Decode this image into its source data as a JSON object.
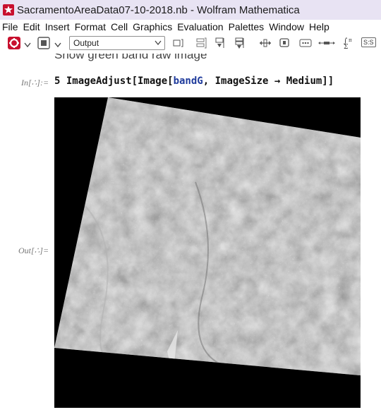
{
  "window": {
    "title": "SacramentoAreaData07-10-2018.nb - Wolfram Mathematica"
  },
  "menu": {
    "items": [
      "File",
      "Edit",
      "Insert",
      "Format",
      "Cell",
      "Graphics",
      "Evaluation",
      "Palettes",
      "Window",
      "Help"
    ]
  },
  "toolbar": {
    "style_value": "Output",
    "sum_icon_label": "Σ",
    "sis_label": "S:S"
  },
  "notebook": {
    "section_text": "Show green band raw image",
    "in_label": "In[∴]:=",
    "out_label": "Out[∴]=",
    "code": {
      "p1": "5 ImageAdjust[Image[",
      "var": "bandG",
      "p2": ", ImageSize → Medium]]"
    }
  },
  "colors": {
    "titlebar_bg": "#e8e3f3",
    "code_var": "#1f3b9c",
    "image_bg": "#000000"
  }
}
